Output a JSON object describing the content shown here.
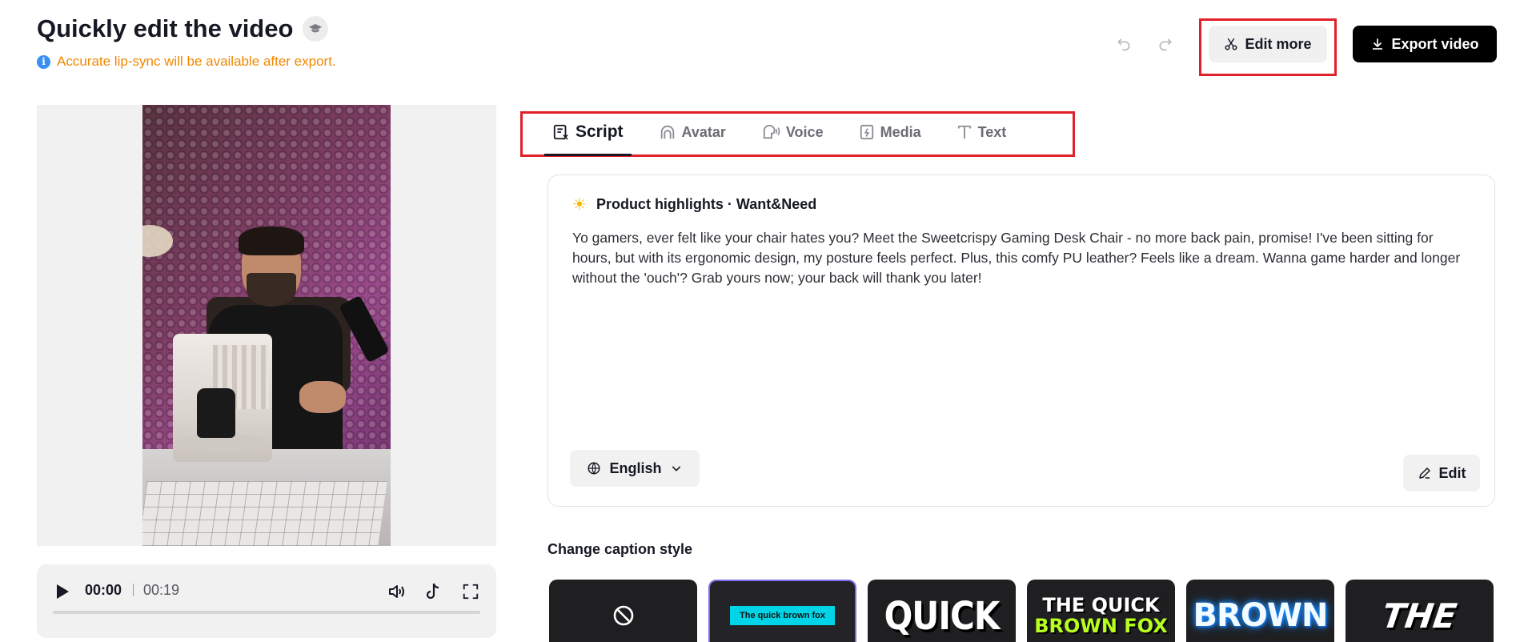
{
  "header": {
    "title": "Quickly edit the video",
    "notice": "Accurate lip-sync will be available after export.",
    "edit_more_label": "Edit more",
    "export_label": "Export video"
  },
  "player": {
    "current_time": "00:00",
    "total_time": "00:19",
    "progress": 0
  },
  "tabs": [
    {
      "label": "Script",
      "icon": "script-icon",
      "active": true
    },
    {
      "label": "Avatar",
      "icon": "avatar-icon",
      "active": false
    },
    {
      "label": "Voice",
      "icon": "voice-icon",
      "active": false
    },
    {
      "label": "Media",
      "icon": "media-icon",
      "active": false
    },
    {
      "label": "Text",
      "icon": "text-icon",
      "active": false
    }
  ],
  "script": {
    "heading": "Product highlights · Want&Need",
    "body": "Yo gamers, ever felt like your chair hates you? Meet the Sweetcrispy Gaming Desk Chair - no more back pain, promise! I've been sitting for hours, but with its ergonomic design, my posture feels perfect. Plus, this comfy PU leather? Feels like a dream. Wanna game harder and longer without the 'ouch'? Grab yours now; your back will thank you later!",
    "language": "English",
    "edit_label": "Edit"
  },
  "captions": {
    "title": "Change caption style",
    "styles": [
      {
        "name": "none",
        "label": ""
      },
      {
        "name": "quick-brown-fox",
        "label": "The quick brown fox",
        "selected": true
      },
      {
        "name": "quick",
        "label": "QUICK"
      },
      {
        "name": "the-quick-brown-fox",
        "line1": "THE QUICK",
        "line2": "BROWN FOX"
      },
      {
        "name": "brown",
        "label": "BROWN"
      },
      {
        "name": "the",
        "label": "THE"
      }
    ]
  },
  "colors": {
    "accent": "#161823",
    "notice": "#f08800",
    "highlight_box": "#e0202a",
    "selected_tile": "#7b6ee6"
  }
}
